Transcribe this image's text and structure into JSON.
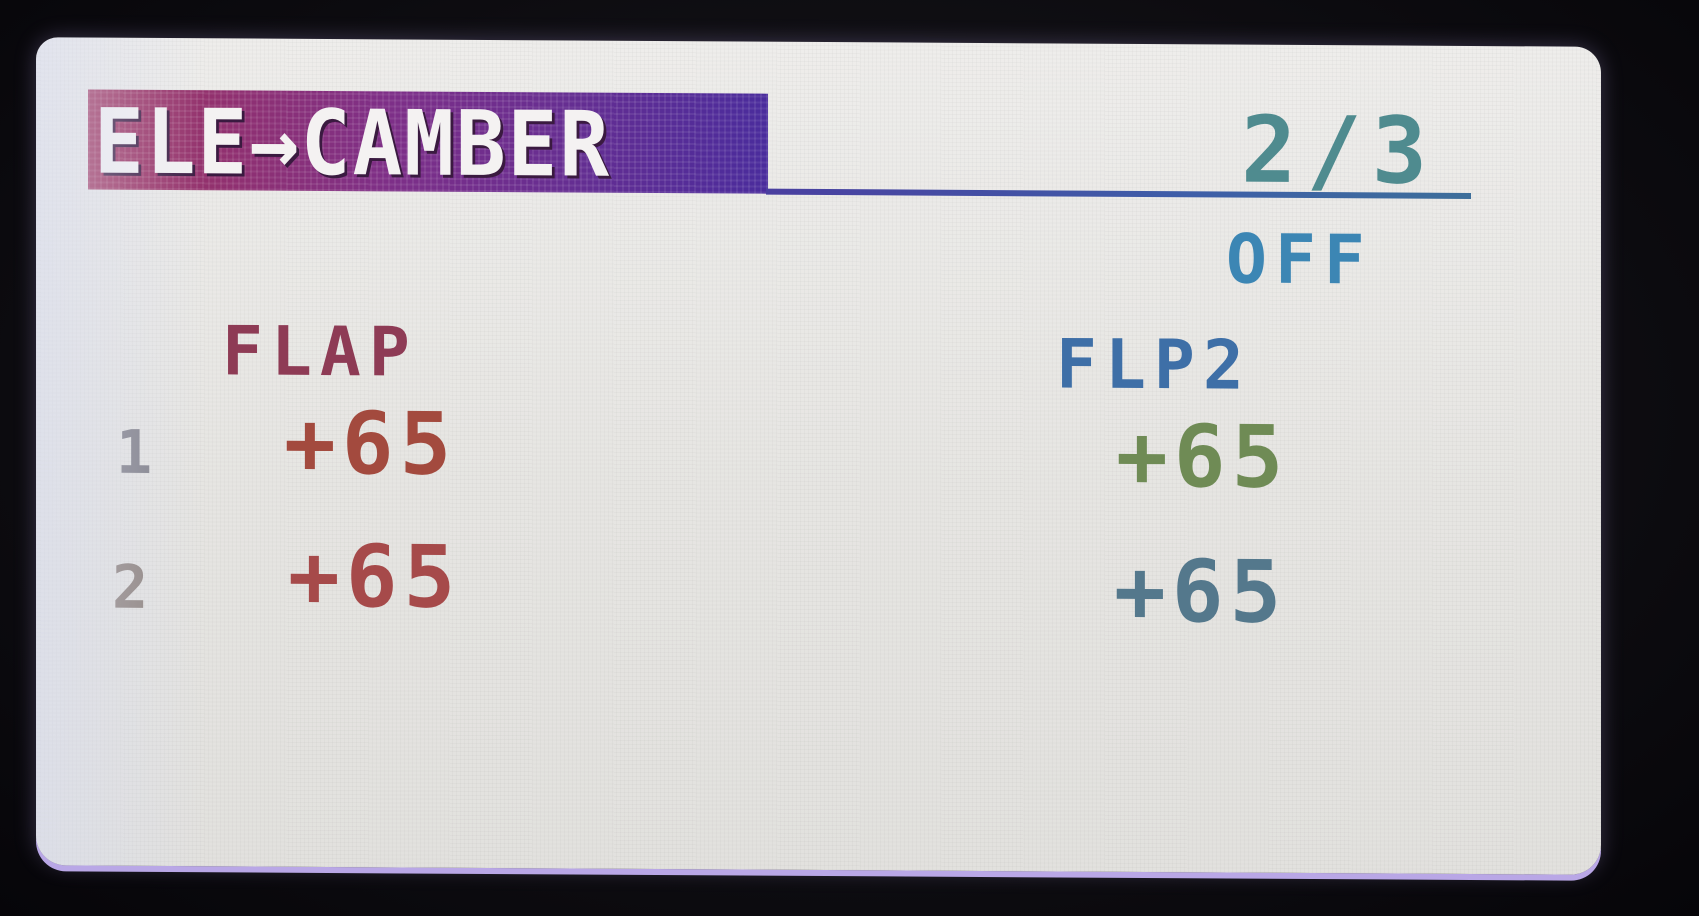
{
  "screen": {
    "title": "ELE→CAMBER",
    "page_indicator": "2/3",
    "status": "OFF"
  },
  "columns": {
    "left_header": "FLAP",
    "right_header": "FLP2"
  },
  "rows": [
    {
      "label": "1",
      "left": "+65",
      "right": "+65"
    },
    {
      "label": "2",
      "left": "+65",
      "right": "+65"
    }
  ]
}
